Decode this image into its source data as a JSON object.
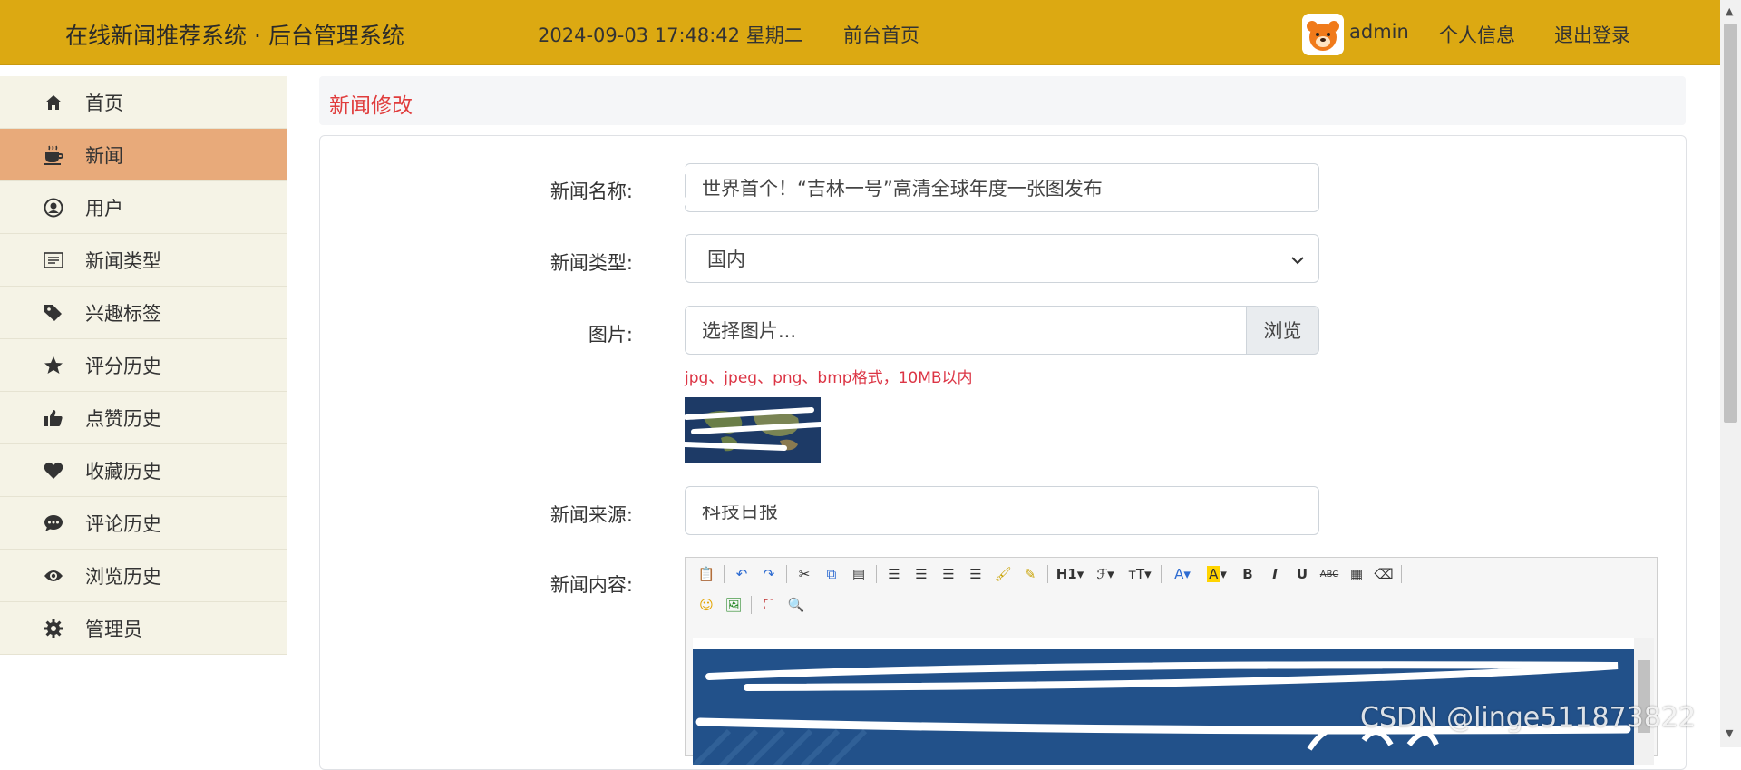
{
  "header": {
    "brand": "在线新闻推荐系统 · 后台管理系统",
    "datetime": "2024-09-03  17:48:42  星期二",
    "home_link": "前台首页",
    "username": "admin",
    "profile_link": "个人信息",
    "logout_link": "退出登录"
  },
  "sidebar": {
    "items": [
      {
        "label": "首页",
        "icon": "home-icon"
      },
      {
        "label": "新闻",
        "icon": "coffee-icon",
        "active": true
      },
      {
        "label": "用户",
        "icon": "user-circle-icon"
      },
      {
        "label": "新闻类型",
        "icon": "list-icon"
      },
      {
        "label": "兴趣标签",
        "icon": "tags-icon"
      },
      {
        "label": "评分历史",
        "icon": "star-icon"
      },
      {
        "label": "点赞历史",
        "icon": "thumbs-up-icon"
      },
      {
        "label": "收藏历史",
        "icon": "heart-icon"
      },
      {
        "label": "评论历史",
        "icon": "comment-icon"
      },
      {
        "label": "浏览历史",
        "icon": "eye-icon"
      },
      {
        "label": "管理员",
        "icon": "gear-icon"
      }
    ]
  },
  "page": {
    "title": "新闻修改"
  },
  "form": {
    "name_label": "新闻名称:",
    "name_value": "世界首个！“吉林一号”高清全球年度一张图发布",
    "type_label": "新闻类型:",
    "type_value": "国内",
    "image_label": "图片:",
    "image_placeholder": "选择图片...",
    "browse_label": "浏览",
    "image_hint": "jpg、jpeg、png、bmp格式，10MB以内",
    "source_label": "新闻来源:",
    "source_value": "科技日报",
    "content_label": "新闻内容:"
  },
  "editor": {
    "toolbar_row1": [
      "paste-icon",
      "undo-icon",
      "redo-icon",
      "cut-icon",
      "copy-icon",
      "paste-text-icon",
      "align-left-icon",
      "align-center-icon",
      "align-right-icon",
      "align-justify-icon",
      "format-brush-icon",
      "paste-word-icon",
      "heading-icon",
      "font-family-icon",
      "font-size-icon",
      "font-color-icon",
      "highlight-icon",
      "bold-icon",
      "italic-icon",
      "underline-icon",
      "strikethrough-icon",
      "table-icon",
      "eraser-icon"
    ],
    "toolbar_row2": [
      "emoji-icon",
      "image-icon",
      "fullscreen-icon",
      "preview-icon"
    ],
    "heading_text": "H1",
    "bold_text": "B",
    "italic_text": "I",
    "underline_text": "U",
    "strike_text": "ABC"
  },
  "watermark": "CSDN @linge511873822",
  "colors": {
    "header_bg": "#dca912",
    "sidebar_bg": "#f5f3e6",
    "sidebar_active": "#e8aa7a",
    "title_red": "#e03c3c",
    "hint_red": "#dc3545"
  }
}
